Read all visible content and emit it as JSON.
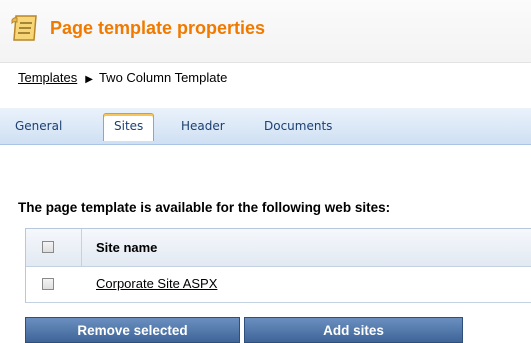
{
  "header": {
    "title": "Page template properties",
    "icon": "page-template-icon"
  },
  "breadcrumb": {
    "parent": "Templates",
    "separator_icon": "arrow-right-icon",
    "current": "Two Column Template"
  },
  "tabs": [
    {
      "label": "General",
      "active": false
    },
    {
      "label": "Sites",
      "active": true
    },
    {
      "label": "Header",
      "active": false
    },
    {
      "label": "Documents",
      "active": false
    }
  ],
  "content": {
    "heading": "The page template is available for the following web sites:",
    "grid": {
      "columns": [
        "Site name"
      ],
      "rows": [
        {
          "site_name": "Corporate Site ASPX",
          "checked": false
        }
      ]
    }
  },
  "actions": {
    "remove_label": "Remove selected",
    "add_label": "Add sites"
  },
  "colors": {
    "title": "#f07a00",
    "tab_text": "#1c3f72",
    "button": "#4a72a8",
    "active_tab_border": "#d59e2d"
  }
}
